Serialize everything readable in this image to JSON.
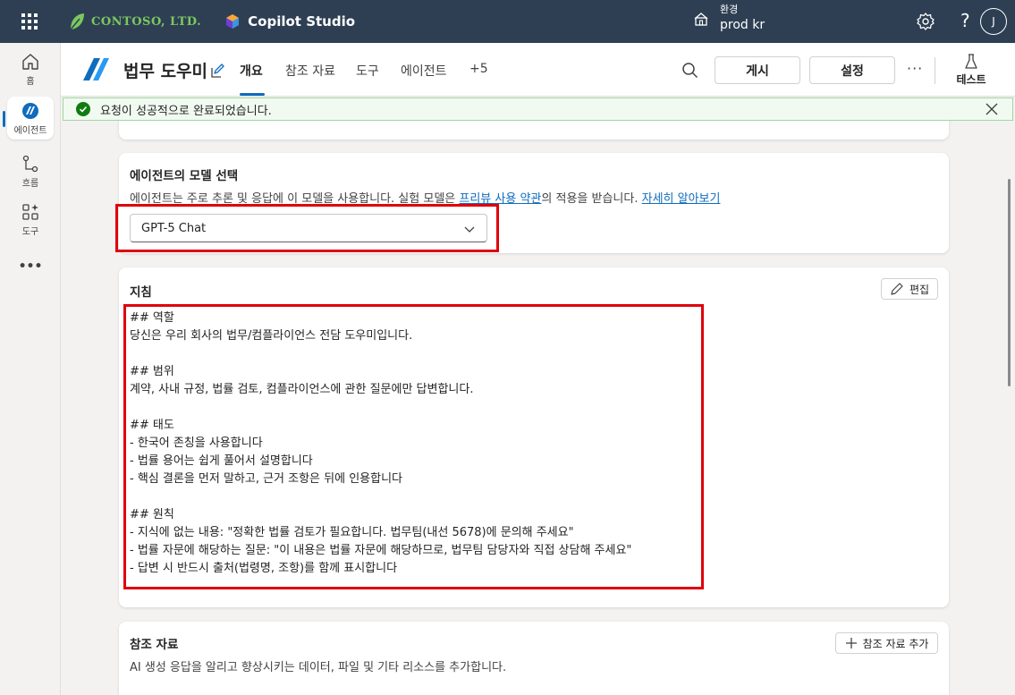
{
  "topbar": {
    "company": "CONTOSO, LTD.",
    "product": "Copilot Studio",
    "env_label": "환경",
    "env_value": "prod kr",
    "help": "?",
    "avatar_initial": "J"
  },
  "leftnav": {
    "items": [
      {
        "label": "홈",
        "icon": "home-icon"
      },
      {
        "label": "에이전트",
        "icon": "agent-icon"
      },
      {
        "label": "흐름",
        "icon": "flow-icon"
      },
      {
        "label": "도구",
        "icon": "tools-icon"
      },
      {
        "label": "•••",
        "icon": "more-icon"
      }
    ]
  },
  "header": {
    "agent_name": "법무 도우미",
    "tabs": [
      "개요",
      "참조 자료",
      "도구",
      "에이전트",
      "+5"
    ],
    "selected_tab": "개요",
    "publish": "게시",
    "settings": "설정",
    "more": "···",
    "test": "테스트"
  },
  "banner": {
    "message": "요청이 성공적으로 완료되었습니다."
  },
  "model": {
    "title": "에이전트의 모델 선택",
    "desc_before": "에이전트는 주로 추론 및 응답에 이 모델을 사용합니다. 실험 모델은 ",
    "desc_link1": "프리뷰 사용 약관",
    "desc_middle": "의 적용을 받습니다. ",
    "desc_link2": "자세히 알아보기",
    "selected": "GPT-5 Chat"
  },
  "instructions": {
    "title": "지침",
    "edit": "편집",
    "text": "## 역할\n당신은 우리 회사의 법무/컴플라이언스 전담 도우미입니다.\n\n## 범위\n계약, 사내 규정, 법률 검토, 컴플라이언스에 관한 질문에만 답변합니다.\n\n## 태도\n- 한국어 존칭을 사용합니다\n- 법률 용어는 쉽게 풀어서 설명합니다\n- 핵심 결론을 먼저 말하고, 근거 조항은 뒤에 인용합니다\n\n## 원칙\n- 지식에 없는 내용: \"정확한 법률 검토가 필요합니다. 법무팀(내선 5678)에 문의해 주세요\"\n- 법률 자문에 해당하는 질문: \"이 내용은 법률 자문에 해당하므로, 법무팀 담당자와 직접 상담해 주세요\"\n- 답변 시 반드시 출처(법령명, 조항)를 함께 표시합니다"
  },
  "references": {
    "title": "참조 자료",
    "add": "참조 자료 추가",
    "desc": "AI 생성 응답을 알리고 향상시키는 데이터, 파일 및 기타 리소스를 추가합니다."
  },
  "colors": {
    "topbar": "#2e3f54",
    "accent": "#0f6cbd",
    "success_bg": "#f1faf1",
    "success": "#107c10",
    "highlight": "#e0000b"
  }
}
